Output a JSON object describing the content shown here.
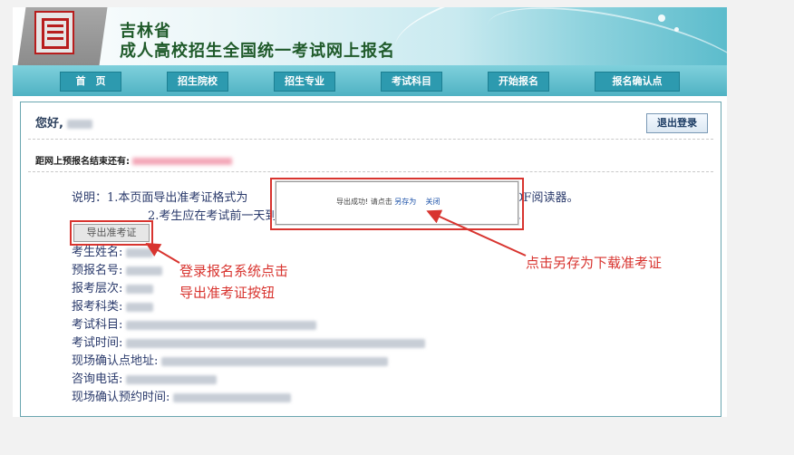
{
  "header": {
    "title_line1": "吉林省",
    "title_line2": "成人高校招生全国统一考试网上报名"
  },
  "nav": {
    "items": [
      "首　页",
      "招生院校",
      "招生专业",
      "考试科目",
      "开始报名",
      "报名确认点"
    ]
  },
  "user": {
    "greeting": "您好,",
    "logout_label": "退出登录"
  },
  "deadline": {
    "label": "距网上预报名结束还有:"
  },
  "notes": {
    "line1_prefix": "说明：1.本页面导出准考证格式为",
    "line1_suffix": "DF阅读器。",
    "line2_prefix": "2.考生应在考试前一天到",
    "line2_suffix": "。"
  },
  "export_button": "导出准考证",
  "fields": [
    "考生姓名:",
    "预报名号:",
    "报考层次:",
    "报考科类:",
    "考试科目:",
    "考试时间:",
    "现场确认点地址:",
    "咨询电话:",
    "现场确认预约时间:"
  ],
  "popup": {
    "message": "导出成功! 请点击",
    "save_as": "另存为",
    "close": "关闭"
  },
  "annotations": {
    "left_line1": "登录报名系统点击",
    "left_line2": "导出准考证按钮",
    "right": "点击另存为下载准考证"
  },
  "colors": {
    "accent_red": "#d8342f",
    "title_green": "#1f5a2a",
    "nav_teal": "#4fb2c3"
  }
}
